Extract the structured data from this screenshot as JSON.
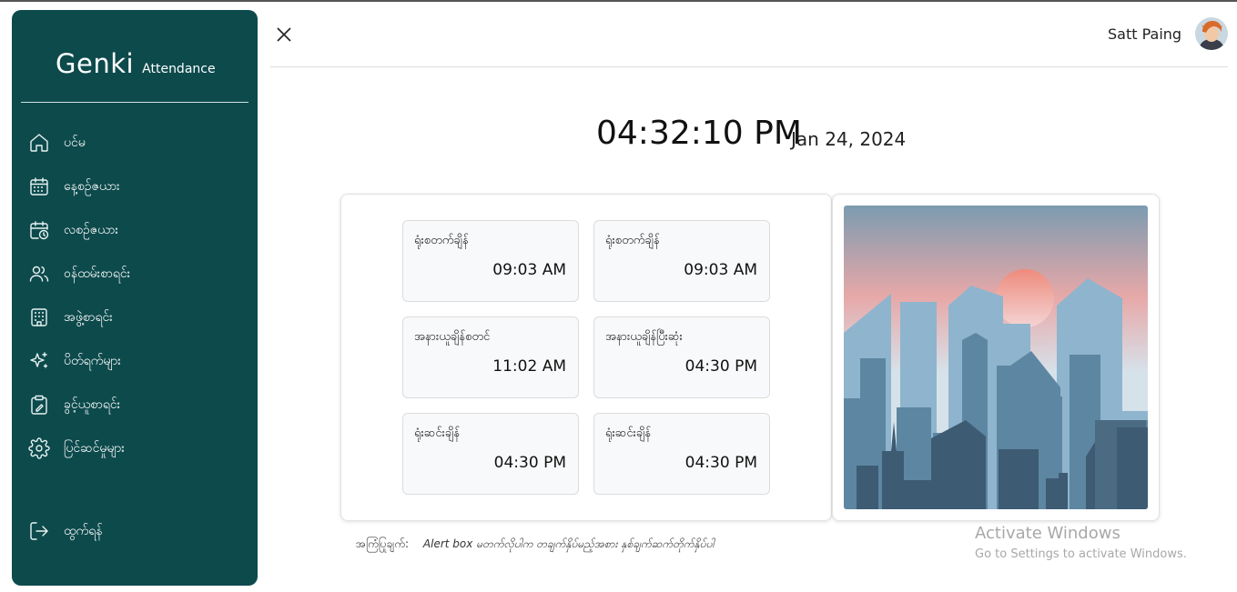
{
  "app": {
    "brand_main": "Genki",
    "brand_sub": "Attendance"
  },
  "colors": {
    "sidebar_bg": "#0d4a4c",
    "accent_white": "#ffffff",
    "tile_bg": "#f8f9fb"
  },
  "sidebar": {
    "items": [
      {
        "label": "ပင်မ",
        "icon": "home-icon"
      },
      {
        "label": "နေ့စဉ်ဇယား",
        "icon": "calendar-icon"
      },
      {
        "label": "လစဉ်ဇယား",
        "icon": "calendar-clock-icon"
      },
      {
        "label": "ဝန်ထမ်းစာရင်း",
        "icon": "users-icon"
      },
      {
        "label": "အဖွဲ့စာရင်း",
        "icon": "building-icon"
      },
      {
        "label": "ပိတ်ရက်များ",
        "icon": "sparkles-icon"
      },
      {
        "label": "ခွင့်ယူစာရင်း",
        "icon": "clipboard-icon"
      },
      {
        "label": "ပြင်ဆင်မှုများ",
        "icon": "gear-icon"
      }
    ],
    "logout": {
      "label": "ထွက်ရန်",
      "icon": "logout-icon"
    }
  },
  "header": {
    "user_name": "Satt Paing"
  },
  "clock": {
    "time": "04:32:10 PM",
    "date": "Jan 24, 2024"
  },
  "schedule": {
    "tiles": [
      {
        "label": "ရုံးစတက်ချိန်",
        "time": "09:03 AM"
      },
      {
        "label": "ရုံးစတက်ချိန်",
        "time": "09:03 AM"
      },
      {
        "label": "အနားယူချိန်စတင်",
        "time": "11:02 AM"
      },
      {
        "label": "အနားယူချိန်ပြီးဆုံး",
        "time": "04:30 PM"
      },
      {
        "label": "ရုံးဆင်းချိန်",
        "time": "04:30 PM"
      },
      {
        "label": "ရုံးဆင်းချိန်",
        "time": "04:30 PM"
      }
    ]
  },
  "alert": {
    "prefix": "အကြံပြုချက်:",
    "text": "Alert box မတက်လိုပါက တချက်နှိပ်မည့်အစား နှစ်ချက်ဆက်တိုက်နှိပ်ပါ"
  },
  "watermark": {
    "title": "Activate Windows",
    "subtitle": "Go to Settings to activate Windows."
  }
}
